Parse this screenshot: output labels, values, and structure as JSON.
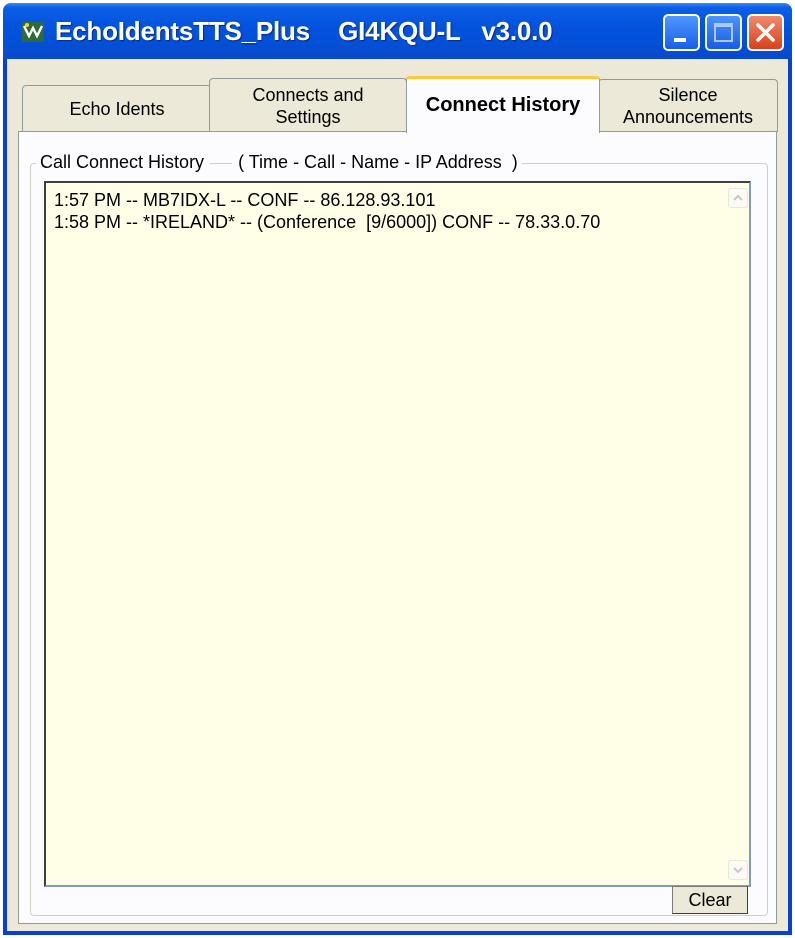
{
  "window": {
    "title": "EchoIdentsTTS_Plus    GI4KQU-L   v3.0.0",
    "controls": {
      "minimize": "minimize-icon",
      "maximize": "maximize-icon",
      "close": "close-icon"
    }
  },
  "tabs": [
    {
      "label": "Echo Idents",
      "active": false
    },
    {
      "label": "Connects and Settings",
      "line1": "Connects and",
      "line2": "Settings",
      "active": false
    },
    {
      "label": "Connect History",
      "active": true
    },
    {
      "label": "Silence Announcements",
      "line1": "Silence",
      "line2": "Announcements",
      "active": false
    }
  ],
  "history": {
    "group_title": "Call Connect History",
    "group_caption": "( Time - Call - Name - IP Address  )",
    "entries": [
      "1:57 PM -- MB7IDX-L -- CONF -- 86.128.93.101",
      "1:58 PM -- *IRELAND* -- (Conference  [9/6000]) CONF -- 78.33.0.70"
    ],
    "clear_label": "Clear"
  },
  "colors": {
    "titlebar": "#0453de",
    "window_face": "#ece9d8",
    "list_background": "#ffffe8",
    "active_tab_highlight": "#ffc83c",
    "close_button": "#d9411a"
  }
}
